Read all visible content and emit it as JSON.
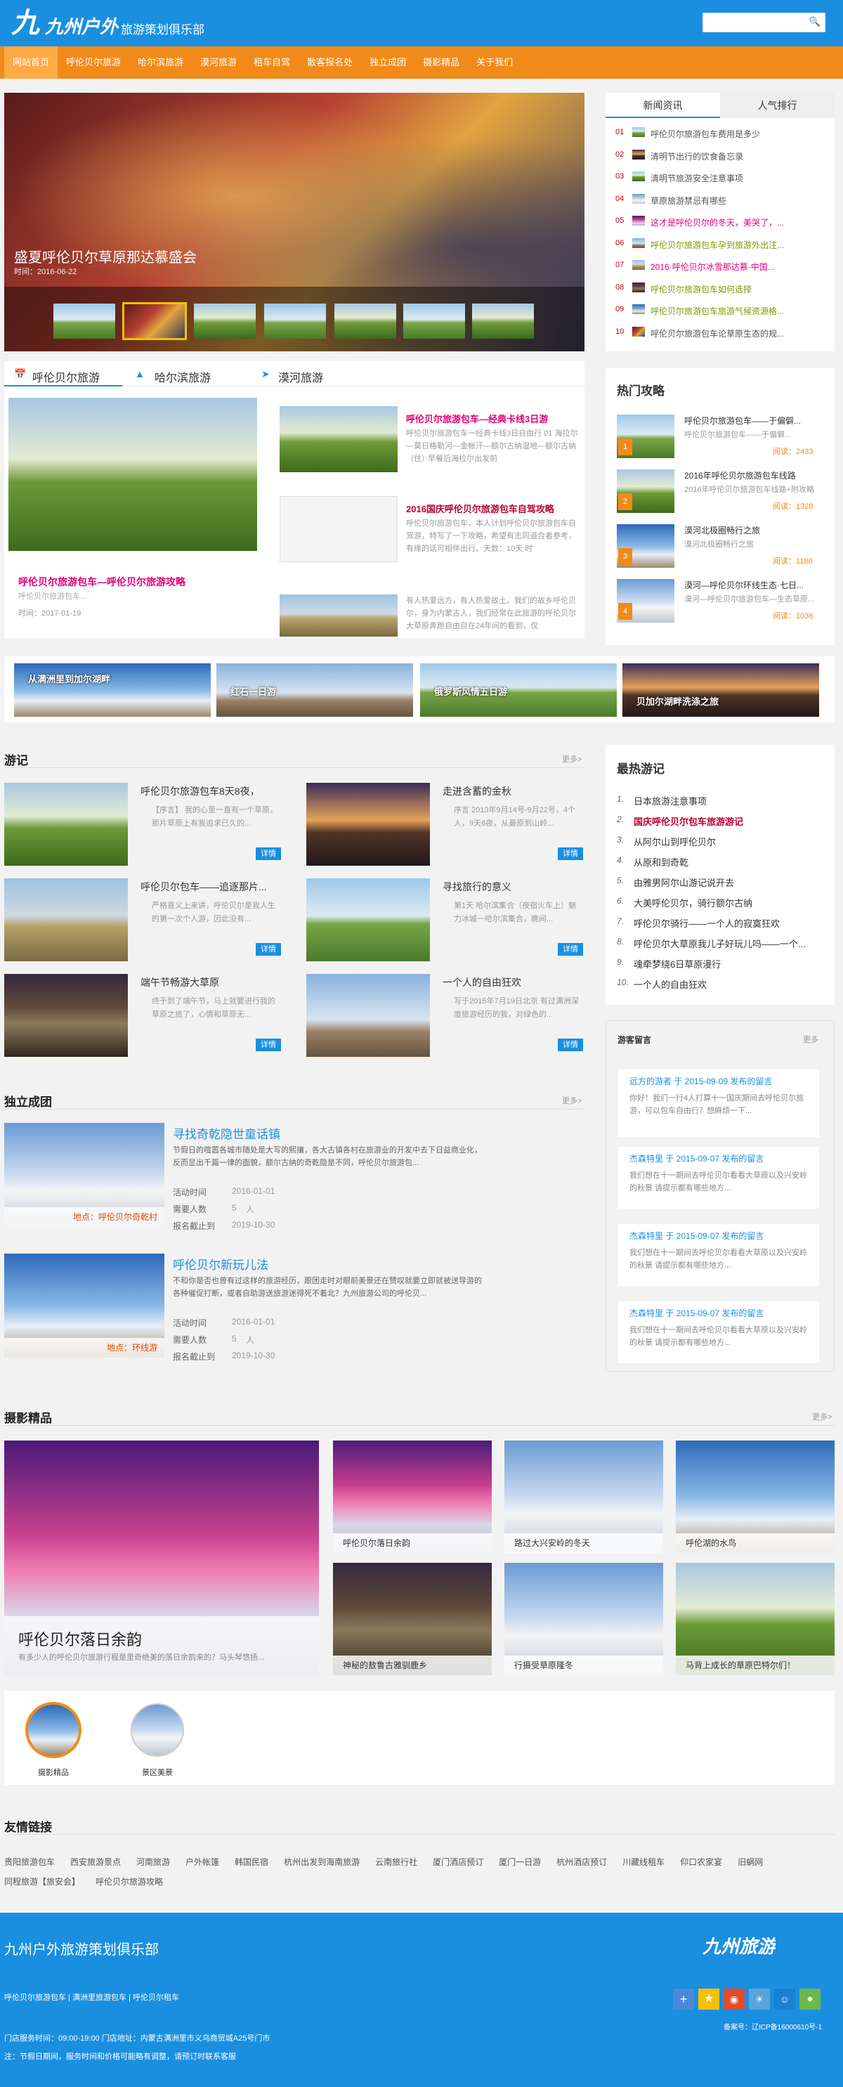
{
  "header": {
    "logo_mark": "九",
    "logo_title": "九州户外",
    "logo_sub": "旅游策划俱乐部",
    "search_placeholder": ""
  },
  "nav": [
    "网站首页",
    "呼伦贝尔旅游",
    "哈尔滨旅游",
    "漠河旅游",
    "租车自驾",
    "散客报名处",
    "独立成团",
    "摄影精品",
    "关于我们"
  ],
  "slider": {
    "caption": "盛夏呼伦贝尔草原那达慕盛会",
    "date": "时间：2016-06-22"
  },
  "news_tabs": [
    "新闻资讯",
    "人气排行"
  ],
  "news": [
    {
      "n": "01",
      "text": "呼伦贝尔旅游包车费用是多少",
      "color": "#555"
    },
    {
      "n": "02",
      "text": "清明节出行的饮食备忘录",
      "color": "#555"
    },
    {
      "n": "03",
      "text": "清明节旅游安全注意事项",
      "color": "#555"
    },
    {
      "n": "04",
      "text": "草原旅游禁忌有哪些",
      "color": "#555"
    },
    {
      "n": "05",
      "text": "这才是呼伦贝尔的冬天，美哭了，...",
      "color": "#e0007a"
    },
    {
      "n": "06",
      "text": "呼伦贝尔旅游包车孕到旅游外出注...",
      "color": "#7a9a00"
    },
    {
      "n": "07",
      "text": "2016·呼伦贝尔冰雪那达慕·中国...",
      "color": "#e0007a"
    },
    {
      "n": "08",
      "text": "呼伦贝尔旅游包车如何选择",
      "color": "#7a9a00"
    },
    {
      "n": "09",
      "text": "呼伦贝尔旅游包车旅游气候资源格...",
      "color": "#7a9a00"
    },
    {
      "n": "10",
      "text": "呼伦贝尔旅游包车论草原生态的规...",
      "color": "#555"
    }
  ],
  "tour_tabs": [
    "呼伦贝尔旅游",
    "哈尔滨旅游",
    "漠河旅游"
  ],
  "tour_main": {
    "title": "呼伦贝尔旅游包车—呼伦贝尔旅游攻略",
    "snippet": "呼伦贝尔旅游包车...",
    "date": "时间：2017-01-19"
  },
  "tour_list": [
    {
      "title": "呼伦贝尔旅游包车—经典卡线3日游",
      "desc": "呼伦贝尔旅游包车一经典卡线3日自由行 01 海拉尔—莫日格勒河—金帐汗—额尔古纳湿地—额尔古纳（住）·早餐后海拉尔出发前",
      "color": "#e0007a"
    },
    {
      "title": "2016国庆呼伦贝尔旅游包车自驾攻略",
      "desc": "呼伦贝尔旅游包车，本人计划呼伦贝尔旅游包车自驾游，特写了一下攻略，希望有志同道合者参考，有缘的话可相伴出行。天数：10天 时",
      "color": "#b8002e"
    },
    {
      "title": "",
      "desc": "有人热爱远方，有人热爱故土。我们的故乡呼伦贝尔，身为内蒙古人，我们经常在此旅游的呼伦贝尔大草原奔跑自由自在24年间的看到，仅",
      "color": "#333"
    }
  ],
  "banners": [
    "从满洲里到加尔湖畔",
    "红石一日游",
    "俄罗斯风情五日游",
    "贝加尔湖畔洗涤之旅"
  ],
  "youji": {
    "title": "游记",
    "more": "更多>",
    "detail_label": "详情",
    "items": [
      {
        "title": "呼伦贝尔旅游包车8天8夜，",
        "desc": "【序言】 我的心里一直有一个草原，那片草原上有我追求已久的..."
      },
      {
        "title": "走进含蓄的金秋",
        "desc": "序言 2013年9月14号-9月22号，4个人，9天8夜，从最原到山岭..."
      },
      {
        "title": "呼伦贝尔包车——追逐那片...",
        "desc": "严格意义上来讲，呼伦贝尔是我人生的第一次个人游，因此没有..."
      },
      {
        "title": "寻找旅行的意义",
        "desc": "第1天 哈尔滨集合（夜宿火车上）魅力冰城一哈尔滨集合，晚间..."
      },
      {
        "title": "端午节畅游大草原",
        "desc": "终于到了端午节，马上就要进行我的草原之旅了，心情和草原无..."
      },
      {
        "title": "一个人的自由狂欢",
        "desc": "写于2015年7月19日北京 有过满洲深度旅游经历的我，对绿色的..."
      }
    ]
  },
  "hot": {
    "title": "热门攻略",
    "read_label": "阅读：",
    "items": [
      {
        "title": "呼伦贝尔旅游包车——于偏僻...",
        "sub": "呼伦贝尔旅游包车——于偏僻...",
        "reads": "2433",
        "badge": "1"
      },
      {
        "title": "2016年呼伦贝尔旅游包车线路",
        "sub": "2016年呼伦贝尔旅游包车线路+附攻略",
        "reads": "1328",
        "badge": "2"
      },
      {
        "title": "漠河北极圈畅行之旅",
        "sub": "漠河北极圈畅行之旅",
        "reads": "1180",
        "badge": "3"
      },
      {
        "title": "漠河—呼伦贝尔环线生态·七日...",
        "sub": "漠河—呼伦贝尔旅游包车—生态草原...",
        "reads": "1036",
        "badge": "4"
      }
    ]
  },
  "best": {
    "title": "最热游记",
    "items": [
      "日本旅游注意事项",
      "国庆呼伦贝尔包车旅游游记",
      "从阿尔山到呼伦贝尔",
      "从原和到奇乾",
      "由雅男阿尔山游记说开去",
      "大美呼伦贝尔，骑行额尔古纳",
      "呼伦贝尔骑行——一个人的寂寞狂欢",
      "呼伦贝尔大草原我儿子好玩儿吗——一个...",
      "魂牵梦绕6日草原漫行",
      "一个人的自由狂欢"
    ]
  },
  "tuan": {
    "title": "独立成团",
    "more": "更多>",
    "labels": {
      "time": "活动时间",
      "need": "需要人数",
      "deadline": "报名截止到"
    },
    "people_unit": "人",
    "items": [
      {
        "title": "寻找奇乾隐世童话镇",
        "desc": "节假日的喧嚣各城市随处是大写的熙攘，各大古镇各村在旅游业的开发中去下日益商业化，反而显出千篇一律的面貌，额尔古纳的奇乾隐是不同，呼伦贝尔旅游包...",
        "time": "2016-01-01",
        "people": "5",
        "deadline": "2019-10-30",
        "place": "地点：呼伦贝尔奇乾村"
      },
      {
        "title": "呼伦贝尔新玩儿法",
        "desc": "不和你是否也曾有过这样的旅游经历，跟团走时对眼前美景还在赞叹就要立即就被送导游的各种催促打断，或者自助游送旅游迷得死不着北？九州旅游公司的呼伦贝...",
        "time": "2016-01-01",
        "people": "5",
        "deadline": "2019-10-30",
        "place": "地点：环线游"
      }
    ]
  },
  "msgs": {
    "title": "游客留言",
    "more": "更多",
    "items": [
      {
        "head": "远方的游者 于 2015-09-09 发布的留言",
        "body": "你好！我们一行4人打算十一国庆期间去呼伦贝尔旅游，可以包车自由行？想麻烦一下..."
      },
      {
        "head": "杰森特里 于 2015-09-07 发布的留言",
        "body": "我们想在十一期间去呼伦贝尔看看大草原以及兴安岭的秋景 请提示都有哪些地方..."
      },
      {
        "head": "杰森特里 于 2015-09-07 发布的留言",
        "body": "我们想在十一期间去呼伦贝尔看看大草原以及兴安岭的秋景 请提示都有哪些地方..."
      },
      {
        "head": "杰森特里 于 2015-09-07 发布的留言",
        "body": "我们想在十一期间去呼伦贝尔看看大草原以及兴安岭的秋景 请提示都有哪些地方..."
      }
    ]
  },
  "photo": {
    "title": "摄影精品",
    "more": "更多>",
    "big_caption": "呼伦贝尔落日余韵",
    "big_sub": "有多少人的呼伦贝尔旅游行程是里奇绝美的落日余韵来的？马头琴悠扬...",
    "items": [
      "呼伦贝尔落日余韵",
      "路过大兴安岭的冬天",
      "呼伦湖的水鸟",
      "神秘的敖鲁古雅驯鹿乡",
      "行摄受草原隆冬",
      "马背上成长的草原巴特尔们！"
    ]
  },
  "icons": [
    "摄影精品",
    "景区美景"
  ],
  "links": {
    "title": "友情链接",
    "items": [
      "贵阳旅游包车",
      "西安旅游景点",
      "河南旅游",
      "户外帐篷",
      "韩国民宿",
      "杭州出发到海南旅游",
      "云南旅行社",
      "厦门酒店预订",
      "厦门一日游",
      "杭州酒店预订",
      "川藏线租车",
      "仰口农家宴",
      "旧蜗网",
      "同程旅游【旅安会】",
      "呼伦贝尔旅游攻略"
    ]
  },
  "footer": {
    "title": "九州户外旅游策划俱乐部",
    "logo": "九州旅游",
    "links": "呼伦贝尔旅游包车 | 满洲里旅游包车 | 呼伦贝尔租车",
    "hours": "门店服务时间：09:00-19:00  门店地址：内蒙古满洲里市义乌商贸城A25号门市",
    "note": "注：节假日期间，服务时间和价格可能略有调整，请预订时联系客服",
    "icp": "备案号：辽ICP备16000610号-1"
  }
}
